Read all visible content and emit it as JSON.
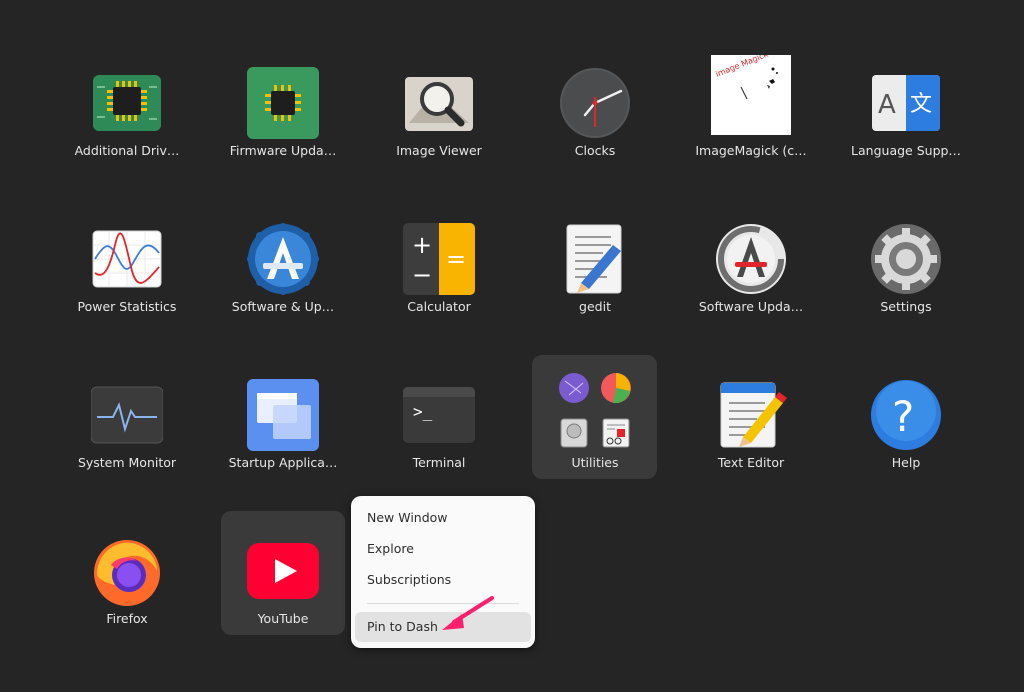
{
  "apps": [
    {
      "label": "Additional Driv…",
      "icon": "chip-green-icon"
    },
    {
      "label": "Firmware Upda…",
      "icon": "chip-green-icon"
    },
    {
      "label": "Image Viewer",
      "icon": "magnifier-photo-icon"
    },
    {
      "label": "Clocks",
      "icon": "clock-icon"
    },
    {
      "label": "ImageMagick (c…",
      "icon": "imagemagick-icon"
    },
    {
      "label": "Language Supp…",
      "icon": "language-icon"
    },
    {
      "label": "Power Statistics",
      "icon": "graph-icon"
    },
    {
      "label": "Software & Up…",
      "icon": "software-sources-icon"
    },
    {
      "label": "Calculator",
      "icon": "calculator-icon"
    },
    {
      "label": "gedit",
      "icon": "gedit-icon"
    },
    {
      "label": "Software Upda…",
      "icon": "software-updater-icon"
    },
    {
      "label": "Settings",
      "icon": "gear-icon"
    },
    {
      "label": "System Monitor",
      "icon": "system-monitor-icon"
    },
    {
      "label": "Startup Applica…",
      "icon": "startup-apps-icon"
    },
    {
      "label": "Terminal",
      "icon": "terminal-icon"
    },
    {
      "label": "Utilities",
      "icon": "folder-utilities-icon"
    },
    {
      "label": "Text Editor",
      "icon": "text-editor-icon"
    },
    {
      "label": "Help",
      "icon": "help-icon"
    },
    {
      "label": "Firefox",
      "icon": "firefox-icon"
    },
    {
      "label": "YouTube",
      "icon": "youtube-icon"
    }
  ],
  "context_menu": {
    "items": [
      "New Window",
      "Explore",
      "Subscriptions",
      "Pin to Dash"
    ]
  },
  "terminal_prompt": ">_",
  "imagemagick_text": "image Magick",
  "calculator_symbols": [
    "+",
    "=",
    "−"
  ],
  "language_glyphs": [
    "A",
    "文"
  ],
  "help_glyph": "?",
  "colors": {
    "background": "#252525",
    "menu_background": "#fafafa",
    "annotation_arrow": "#ff1f6f"
  }
}
